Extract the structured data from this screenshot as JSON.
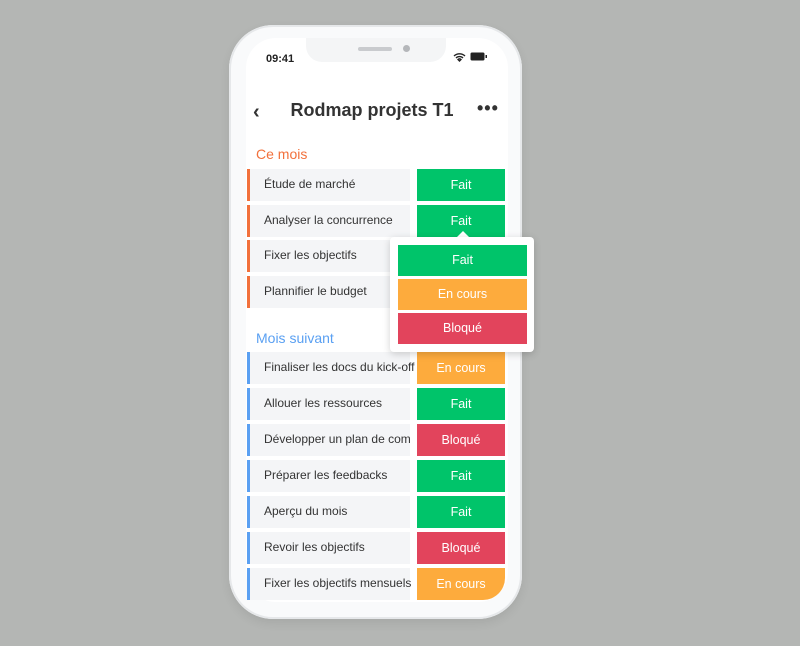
{
  "status_bar": {
    "time": "09:41"
  },
  "header": {
    "title": "Rodmap projets T1",
    "back": "‹",
    "more": "•••"
  },
  "colors": {
    "fait": "#00c46a",
    "en_cours": "#fdab3d",
    "bloque": "#e2445c",
    "this_month": "#f2713c",
    "next_month": "#5aa0f2"
  },
  "sections": [
    {
      "title": "Ce mois",
      "items": [
        {
          "label": "Étude de marché",
          "status": "Fait"
        },
        {
          "label": "Analyser la concurrence",
          "status": "Fait"
        },
        {
          "label": "Fixer les objectifs",
          "status": ""
        },
        {
          "label": "Plannifier le budget",
          "status": ""
        }
      ]
    },
    {
      "title": "Mois suivant",
      "items": [
        {
          "label": "Finaliser les docs du kick-off",
          "status": "En cours"
        },
        {
          "label": "Allouer les ressources",
          "status": "Fait"
        },
        {
          "label": "Développer un plan de com",
          "status": "Bloqué"
        },
        {
          "label": "Préparer les feedbacks",
          "status": "Fait"
        },
        {
          "label": "Aperçu du mois",
          "status": "Fait"
        },
        {
          "label": "Revoir les objectifs",
          "status": "Bloqué"
        },
        {
          "label": "Fixer les objectifs mensuels",
          "status": "En cours"
        }
      ]
    }
  ],
  "status_dropdown": {
    "options": [
      "Fait",
      "En cours",
      "Bloqué"
    ]
  }
}
